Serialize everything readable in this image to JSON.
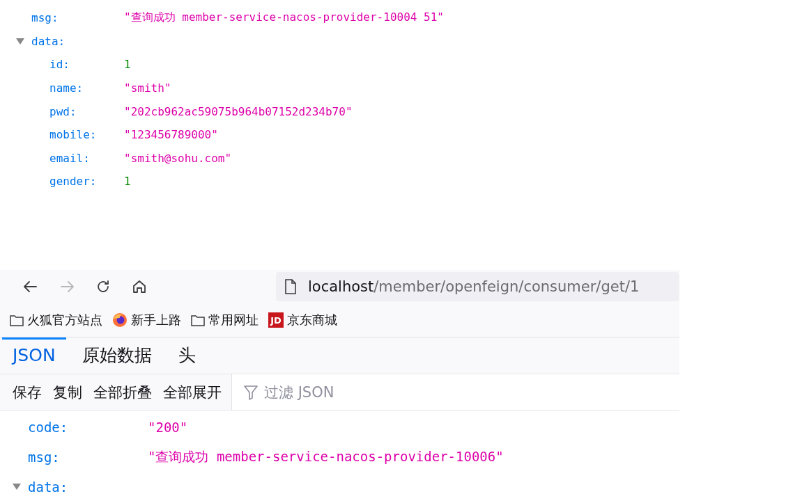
{
  "top_view": {
    "rows": [
      {
        "key": "msg:",
        "kind": "string",
        "value": "\"查询成功 member-service-nacos-provider-10004 51\""
      },
      {
        "key": "data:",
        "kind": "object",
        "expanded": true,
        "children": [
          {
            "key": "id:",
            "kind": "number",
            "value": "1"
          },
          {
            "key": "name:",
            "kind": "string",
            "value": "\"smith\""
          },
          {
            "key": "pwd:",
            "kind": "string",
            "value": "\"202cb962ac59075b964b07152d234b70\""
          },
          {
            "key": "mobile:",
            "kind": "string",
            "value": "\"123456789000\""
          },
          {
            "key": "email:",
            "kind": "string",
            "value": "\"smith@sohu.com\""
          },
          {
            "key": "gender:",
            "kind": "number",
            "value": "1"
          }
        ]
      }
    ]
  },
  "browser": {
    "nav": [
      {
        "kind": "back",
        "disabled": false
      },
      {
        "kind": "forward",
        "disabled": true
      },
      {
        "kind": "reload",
        "disabled": false
      },
      {
        "kind": "home",
        "disabled": false
      }
    ],
    "url": {
      "host": "localhost",
      "path": "/member/openfeign/consumer/get/1"
    },
    "bookmarks": [
      {
        "kind": "folder",
        "label": "火狐官方站点"
      },
      {
        "kind": "firefox",
        "label": "新手上路"
      },
      {
        "kind": "folder",
        "label": "常用网址"
      },
      {
        "kind": "jd",
        "badge": "JD",
        "label": "京东商城"
      }
    ],
    "tabs": [
      {
        "label": "JSON",
        "selected": true
      },
      {
        "label": "原始数据",
        "selected": false
      },
      {
        "label": "头",
        "selected": false
      }
    ],
    "toolbar": [
      "保存",
      "复制",
      "全部折叠",
      "全部展开"
    ],
    "filter": {
      "placeholder": "过滤 JSON"
    },
    "rows": [
      {
        "key": "code:",
        "kind": "string",
        "value": "\"200\""
      },
      {
        "key": "msg:",
        "kind": "string",
        "value": "\"查询成功 member-service-nacos-provider-10006\""
      },
      {
        "key": "data:",
        "kind": "object",
        "expanded": true
      }
    ]
  }
}
